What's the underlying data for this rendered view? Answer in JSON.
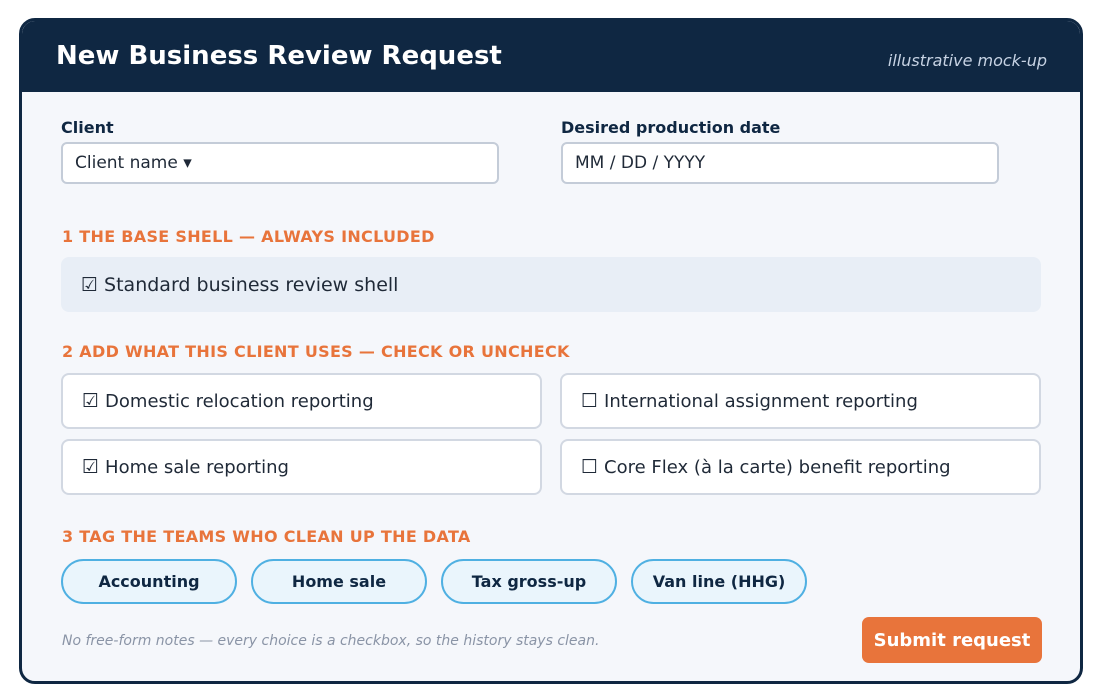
{
  "header": {
    "title": "New Business Review Request",
    "note": "illustrative mock-up"
  },
  "fields": {
    "client_label": "Client",
    "client_value": "Client name ▾",
    "date_label": "Desired production date",
    "date_placeholder": "MM / DD / YYYY"
  },
  "section1": {
    "heading": "1 THE BASE SHELL — ALWAYS INCLUDED",
    "base_item": {
      "box": "☑",
      "label": "Standard business review shell",
      "checked": true
    }
  },
  "section2": {
    "heading": "2 ADD WHAT THIS CLIENT USES — CHECK OR UNCHECK",
    "options": [
      {
        "box": "☑",
        "label": "Domestic relocation reporting",
        "checked": true
      },
      {
        "box": "☐",
        "label": "International assignment reporting",
        "checked": false
      },
      {
        "box": "☑",
        "label": "Home sale reporting",
        "checked": true
      },
      {
        "box": "☐",
        "label": "Core Flex (à la carte) benefit reporting",
        "checked": false
      }
    ]
  },
  "section3": {
    "heading": "3 TAG THE TEAMS WHO CLEAN UP THE DATA",
    "tags": [
      "Accounting",
      "Home sale",
      "Tax gross-up",
      "Van line (HHG)"
    ]
  },
  "footer": {
    "note": "No free-form notes — every choice is a checkbox, so the history stays clean.",
    "submit_label": "Submit request"
  },
  "colors": {
    "header_bg": "#0f2742",
    "accent": "#e8743b",
    "tag_border": "#4fb0e2"
  }
}
